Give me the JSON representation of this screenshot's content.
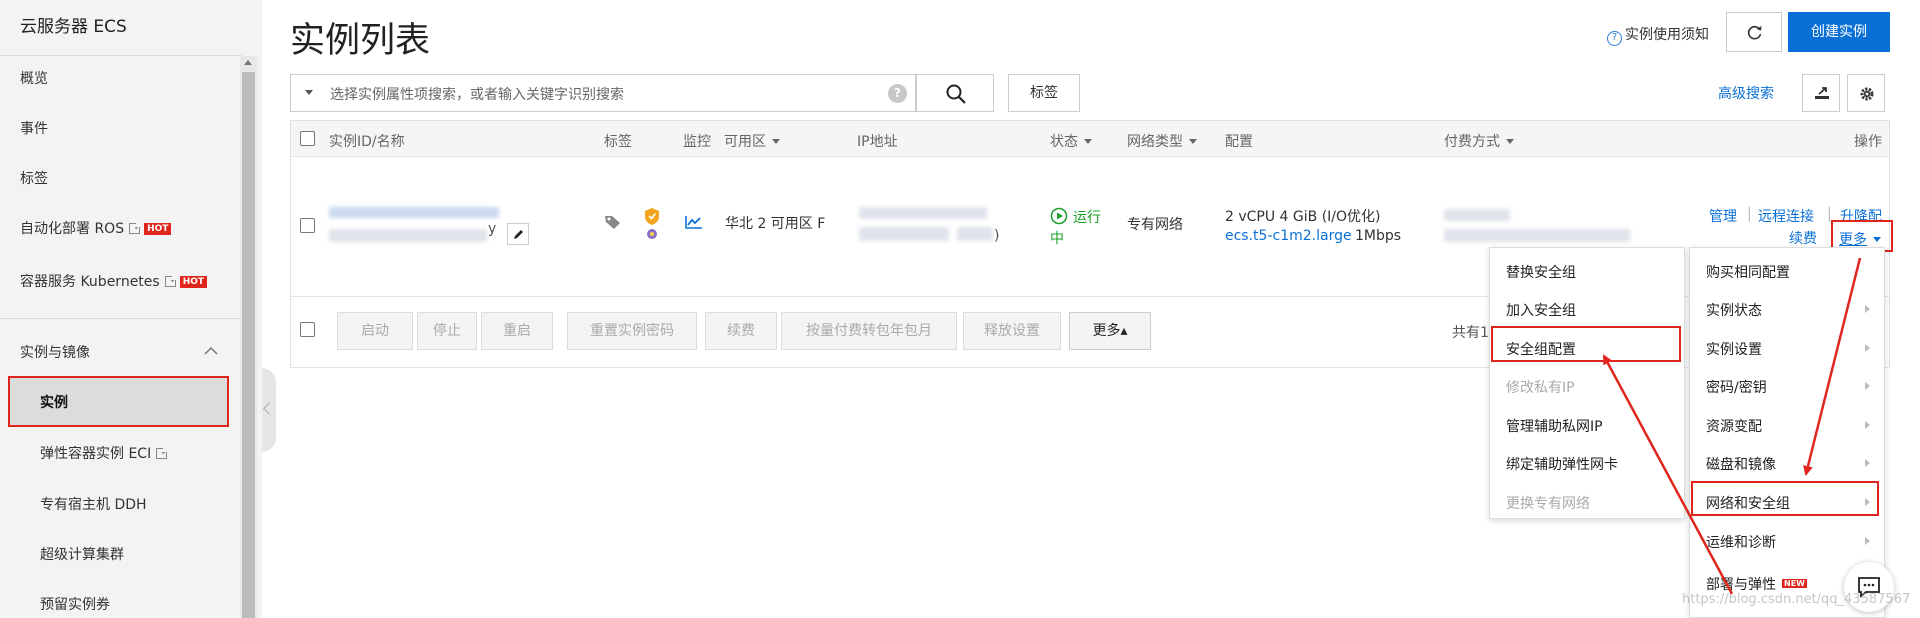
{
  "sidebar": {
    "title": "云服务器 ECS",
    "items": [
      {
        "label": "概览"
      },
      {
        "label": "事件"
      },
      {
        "label": "标签"
      },
      {
        "label": "自动化部署 ROS",
        "hot": "HOT"
      },
      {
        "label": "容器服务 Kubernetes",
        "hot": "HOT"
      }
    ],
    "section": "实例与镜像",
    "subitems": [
      {
        "label": "实例"
      },
      {
        "label": "弹性容器实例 ECI"
      },
      {
        "label": "专有宿主机 DDH"
      },
      {
        "label": "超级计算集群"
      },
      {
        "label": "预留实例券"
      }
    ]
  },
  "header": {
    "title": "实例列表",
    "notice": "实例使用须知",
    "create_label": "创建实例"
  },
  "search": {
    "placeholder": "选择实例属性项搜索，或者输入关键字识别搜索",
    "help": "?",
    "tag_label": "标签",
    "advanced_label": "高级搜索"
  },
  "table": {
    "headers": {
      "id": "实例ID/名称",
      "tag": "标签",
      "monitor": "监控",
      "zone": "可用区",
      "ip": "IP地址",
      "status": "状态",
      "network": "网络类型",
      "config": "配置",
      "billing": "付费方式",
      "actions": "操作"
    },
    "row": {
      "id_suffix": "y",
      "zone": "华北 2 可用区 F",
      "ip_suffix": ")",
      "status_line1": "运行",
      "status_line2": "中",
      "network": "专有网络",
      "config_line1": "2 vCPU 4 GiB   (I/O优化)",
      "config_type": "ecs.t5-c1m2.large",
      "config_bw": "1Mbps",
      "actions": {
        "manage": "管理",
        "remote": "远程连接",
        "upgrade": "升降配",
        "renew": "续费",
        "more": "更多"
      }
    },
    "footer": {
      "buttons": [
        "启动",
        "停止",
        "重启",
        "重置实例密码",
        "续费",
        "按量付费转包年包月",
        "释放设置"
      ],
      "more_label": "更多▴",
      "total_prefix": "共有1"
    }
  },
  "menus": {
    "main": [
      {
        "label": "购买相同配置",
        "arrow": false
      },
      {
        "label": "实例状态",
        "arrow": true
      },
      {
        "label": "实例设置",
        "arrow": true
      },
      {
        "label": "密码/密钥",
        "arrow": true
      },
      {
        "label": "资源变配",
        "arrow": true
      },
      {
        "label": "磁盘和镜像",
        "arrow": true
      },
      {
        "label": "网络和安全组",
        "arrow": true
      },
      {
        "label": "运维和诊断",
        "arrow": true
      },
      {
        "label": "部署与弹性",
        "arrow": false,
        "badge": "NEW"
      }
    ],
    "sub": [
      {
        "label": "替换安全组",
        "disabled": false
      },
      {
        "label": "加入安全组",
        "disabled": false
      },
      {
        "label": "安全组配置",
        "disabled": false
      },
      {
        "label": "修改私有IP",
        "disabled": true
      },
      {
        "label": "管理辅助私网IP",
        "disabled": false
      },
      {
        "label": "绑定辅助弹性网卡",
        "disabled": false
      },
      {
        "label": "更换专有网络",
        "disabled": true
      }
    ]
  },
  "watermark": "https://blog.csdn.net/qq_43587567",
  "colors": {
    "accent": "#0a70d6",
    "highlight": "#e0261c",
    "running": "#1aa028"
  }
}
